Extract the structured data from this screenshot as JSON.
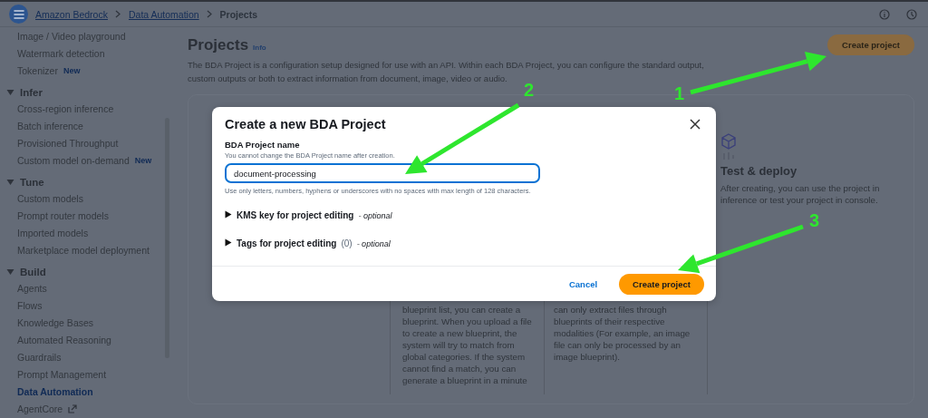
{
  "top_bar": {
    "breadcrumbs": [
      {
        "label": "Amazon Bedrock",
        "link": true
      },
      {
        "label": "Data Automation",
        "link": true
      },
      {
        "label": "Projects",
        "link": false
      }
    ]
  },
  "sidebar": {
    "items": [
      {
        "label": "Image / Video playground",
        "selected": false
      },
      {
        "label": "Watermark detection",
        "selected": false
      },
      {
        "label": "Tokenizer",
        "badge": "New",
        "selected": false
      }
    ],
    "sections": [
      {
        "title": "Infer",
        "expanded": true,
        "items": [
          {
            "label": "Cross-region inference",
            "selected": false
          },
          {
            "label": "Batch inference",
            "selected": false
          },
          {
            "label": "Provisioned Throughput",
            "selected": false
          },
          {
            "label": "Custom model on-demand",
            "badge": "New",
            "selected": false
          }
        ]
      },
      {
        "title": "Tune",
        "expanded": true,
        "items": [
          {
            "label": "Custom models",
            "selected": false
          },
          {
            "label": "Prompt router models",
            "selected": false
          },
          {
            "label": "Imported models",
            "selected": false
          },
          {
            "label": "Marketplace model deployment",
            "selected": false
          }
        ]
      },
      {
        "title": "Build",
        "expanded": true,
        "items": [
          {
            "label": "Agents",
            "selected": false
          },
          {
            "label": "Flows",
            "selected": false
          },
          {
            "label": "Knowledge Bases",
            "selected": false
          },
          {
            "label": "Automated Reasoning",
            "selected": false
          },
          {
            "label": "Guardrails",
            "selected": false
          },
          {
            "label": "Prompt Management",
            "selected": false
          },
          {
            "label": "Data Automation",
            "selected": true
          },
          {
            "label": "AgentCore",
            "external": true,
            "selected": false
          }
        ]
      }
    ]
  },
  "page": {
    "title": "Projects",
    "info": "Info",
    "description": "The BDA Project is a configuration setup designed for use with an API. Within each BDA Project, you can configure the standard output, custom outputs or both to extract information from document, image, video or audio.",
    "create_button": "Create project"
  },
  "how_it_works": {
    "columns": [
      {
        "kind": "text",
        "text": "blueprint list, you can create a blueprint. When you upload a file to create a new blueprint, the system will try to match from global categories. If the system cannot find a match, you can generate a blueprint in a minute"
      },
      {
        "kind": "text",
        "text": "can only extract files through blueprints of their respective modalities (For example, an image file can only be processed by an image blueprint)."
      },
      {
        "kind": "step",
        "title": "Test & deploy",
        "text": "After creating, you can use the project in inference or test your project in console."
      }
    ]
  },
  "modal": {
    "title": "Create a new BDA Project",
    "field_label": "BDA Project name",
    "field_description": "You cannot change the BDA Project name after creation.",
    "value": "document-processing",
    "constraint": "Use only letters, numbers, hyphens or underscores with no spaces with max length of 128 characters.",
    "expanders": [
      {
        "label": "KMS key for project editing",
        "optional": "- optional",
        "expanded": false
      },
      {
        "label": "Tags for project editing",
        "count": "(0)",
        "optional": "- optional",
        "expanded": false
      }
    ],
    "cancel": "Cancel",
    "submit": "Create project"
  },
  "annotations": [
    {
      "label": "1"
    },
    {
      "label": "2"
    },
    {
      "label": "3"
    }
  ]
}
